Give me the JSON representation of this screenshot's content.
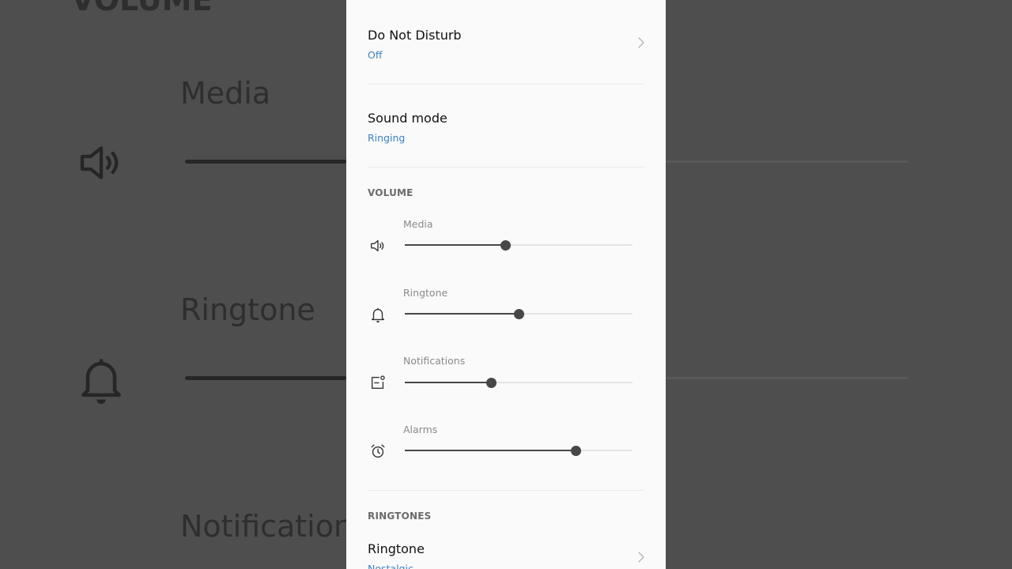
{
  "background": {
    "heading": "VOLUME",
    "media_label": "Media",
    "ringtone_label": "Ringtone",
    "notifications_label": "Notifications"
  },
  "settings": {
    "do_not_disturb": {
      "title": "Do Not Disturb",
      "value": "Off"
    },
    "sound_mode": {
      "title": "Sound mode",
      "value": "Ringing"
    }
  },
  "volume": {
    "heading": "VOLUME",
    "sliders": [
      {
        "label": "Media",
        "icon": "speaker-icon",
        "level": 0.44
      },
      {
        "label": "Ringtone",
        "icon": "bell-icon",
        "level": 0.5
      },
      {
        "label": "Notifications",
        "icon": "notification-icon",
        "level": 0.38
      },
      {
        "label": "Alarms",
        "icon": "alarm-clock-icon",
        "level": 0.75
      }
    ]
  },
  "ringtones": {
    "heading": "RINGTONES",
    "ringtone": {
      "title": "Ringtone",
      "value": "Nostalgic"
    }
  },
  "colors": {
    "accent": "#3a82c4",
    "panel_bg": "#fafafa",
    "overlay": "#4e4e4e"
  }
}
